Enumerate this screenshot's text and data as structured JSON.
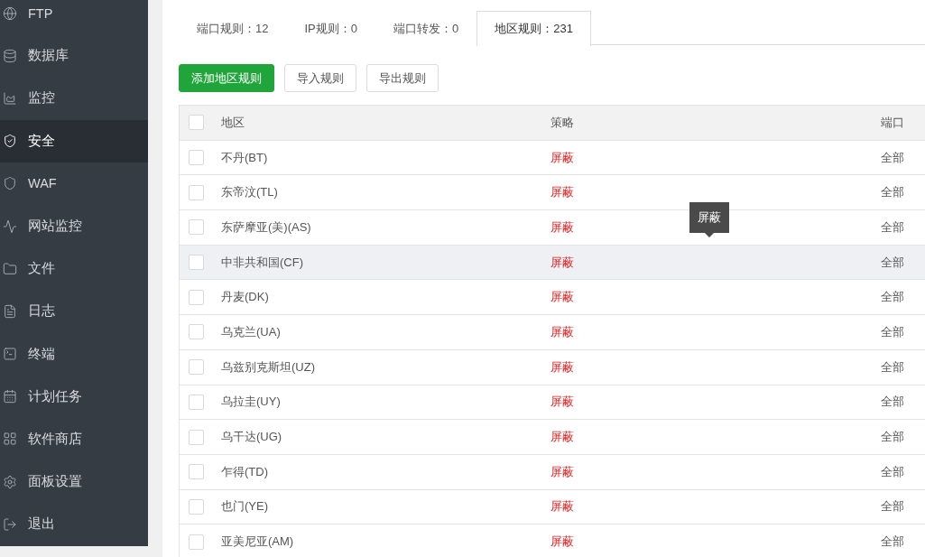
{
  "sidebar": {
    "items": [
      {
        "label": "FTP",
        "selected": false
      },
      {
        "label": "数据库",
        "selected": false
      },
      {
        "label": "监控",
        "selected": false
      },
      {
        "label": "安全",
        "selected": true
      },
      {
        "label": "WAF",
        "selected": false
      },
      {
        "label": "网站监控",
        "selected": false
      },
      {
        "label": "文件",
        "selected": false
      },
      {
        "label": "日志",
        "selected": false
      },
      {
        "label": "终端",
        "selected": false
      },
      {
        "label": "计划任务",
        "selected": false
      },
      {
        "label": "软件商店",
        "selected": false
      },
      {
        "label": "面板设置",
        "selected": false
      },
      {
        "label": "退出",
        "selected": false
      }
    ]
  },
  "tabs": [
    {
      "label": "端口规则：12",
      "selected": false
    },
    {
      "label": "IP规则：0",
      "selected": false
    },
    {
      "label": "端口转发：0",
      "selected": false
    },
    {
      "label": "地区规则：231",
      "selected": true
    }
  ],
  "toolbar": {
    "buttons": [
      {
        "label": "添加地区规则",
        "kind": "primary"
      },
      {
        "label": "导入规则",
        "kind": "default"
      },
      {
        "label": "导出规则",
        "kind": "default"
      }
    ]
  },
  "table": {
    "columns": [
      "地区",
      "策略",
      "端口"
    ],
    "header_checked": false,
    "rows": [
      {
        "region": "不丹(BT)",
        "policy": "屏蔽",
        "port": "全部",
        "checked": false,
        "hovered": false
      },
      {
        "region": "东帝汶(TL)",
        "policy": "屏蔽",
        "port": "全部",
        "checked": false,
        "hovered": false
      },
      {
        "region": "东萨摩亚(美)(AS)",
        "policy": "屏蔽",
        "port": "全部",
        "checked": false,
        "hovered": false
      },
      {
        "region": "中非共和国(CF)",
        "policy": "屏蔽",
        "port": "全部",
        "checked": false,
        "hovered": true
      },
      {
        "region": "丹麦(DK)",
        "policy": "屏蔽",
        "port": "全部",
        "checked": false,
        "hovered": false
      },
      {
        "region": "乌克兰(UA)",
        "policy": "屏蔽",
        "port": "全部",
        "checked": false,
        "hovered": false
      },
      {
        "region": "乌兹别克斯坦(UZ)",
        "policy": "屏蔽",
        "port": "全部",
        "checked": false,
        "hovered": false
      },
      {
        "region": "乌拉圭(UY)",
        "policy": "屏蔽",
        "port": "全部",
        "checked": false,
        "hovered": false
      },
      {
        "region": "乌干达(UG)",
        "policy": "屏蔽",
        "port": "全部",
        "checked": false,
        "hovered": false
      },
      {
        "region": "乍得(TD)",
        "policy": "屏蔽",
        "port": "全部",
        "checked": false,
        "hovered": false
      },
      {
        "region": "也门(YE)",
        "policy": "屏蔽",
        "port": "全部",
        "checked": false,
        "hovered": false
      },
      {
        "region": "亚美尼亚(AM)",
        "policy": "屏蔽",
        "port": "全部",
        "checked": false,
        "hovered": false
      }
    ],
    "tooltip": {
      "text": "屏蔽"
    }
  }
}
